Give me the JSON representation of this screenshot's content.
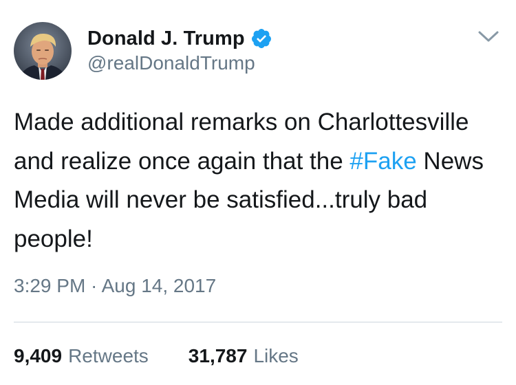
{
  "tweet": {
    "author": {
      "display_name": "Donald J. Trump",
      "handle": "@realDonaldTrump",
      "verified": true
    },
    "text": {
      "before": "Made additional remarks on Charlottesville and realize once again that the ",
      "hashtag": "#Fake",
      "after": " News Media will never be satisfied...truly bad people!"
    },
    "timestamp": "3:29 PM · Aug 14, 2017",
    "stats": {
      "retweets_count": "9,409",
      "retweets_label": "Retweets",
      "likes_count": "31,787",
      "likes_label": "Likes"
    }
  },
  "icons": {
    "verified": "verified-badge-icon",
    "caret": "chevron-down-icon"
  },
  "colors": {
    "hashtag": "#1da1f2",
    "verified_badge": "#1da1f2",
    "secondary_text": "#657786",
    "primary_text": "#14171a",
    "divider": "#ccd6dd"
  }
}
